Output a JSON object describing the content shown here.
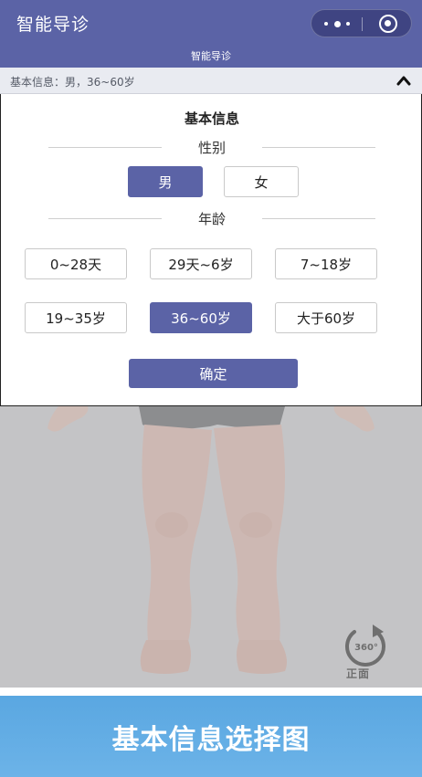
{
  "header": {
    "app_title": "智能导诊",
    "subtitle": "智能导诊",
    "more_icon": "more-dots-icon",
    "close_icon": "target-close-icon",
    "color": "#5b63a6"
  },
  "summary": {
    "text": "基本信息：男，36~60岁",
    "toggle_icon": "chevron-up-icon"
  },
  "panel": {
    "title": "基本信息",
    "gender_label": "性别",
    "gender_options": [
      {
        "label": "男",
        "selected": true
      },
      {
        "label": "女",
        "selected": false
      }
    ],
    "age_label": "年龄",
    "age_options": [
      {
        "label": "0~28天",
        "selected": false
      },
      {
        "label": "29天~6岁",
        "selected": false
      },
      {
        "label": "7~18岁",
        "selected": false
      },
      {
        "label": "19~35岁",
        "selected": false
      },
      {
        "label": "36~60岁",
        "selected": true
      },
      {
        "label": "大于60岁",
        "selected": false
      }
    ],
    "confirm_label": "确定"
  },
  "body_view": {
    "rotate_icon": "rotate-360-icon",
    "rotate_icon_text": "360°",
    "view_label": "正面"
  },
  "caption": {
    "text": "基本信息选择图",
    "color": "#5aa7e1"
  }
}
